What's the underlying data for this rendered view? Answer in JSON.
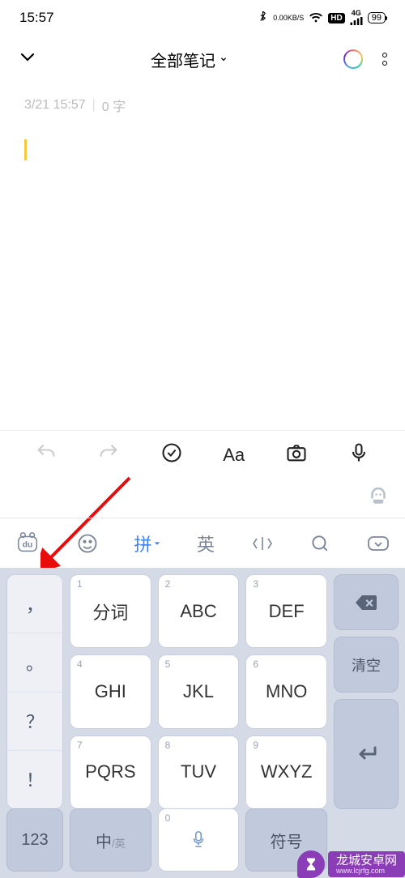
{
  "status": {
    "time": "15:57",
    "net_rate": "0.00",
    "net_unit": "KB/S",
    "hd": "HD",
    "sig": "4G",
    "battery": "99"
  },
  "header": {
    "title": "全部笔记"
  },
  "note_meta": {
    "date": "3/21 15:57",
    "words": "0 字"
  },
  "toolbar": {
    "aa": "Aa"
  },
  "ime": {
    "pin": "拼",
    "eng": "英",
    "left_syms": [
      "，",
      "。",
      "？",
      "！"
    ],
    "keys": {
      "k1_label": "分词",
      "k2_num": "2",
      "k2_label": "ABC",
      "k3_num": "3",
      "k3_label": "DEF",
      "k4_num": "4",
      "k4_label": "GHI",
      "k5_num": "5",
      "k5_label": "JKL",
      "k6_num": "6",
      "k6_label": "MNO",
      "k7_num": "7",
      "k7_label": "PQRS",
      "k8_num": "8",
      "k8_label": "TUV",
      "k9_num": "9",
      "k9_label": "WXYZ",
      "clear": "清空",
      "num": "123",
      "zh": "中",
      "zh_sub": "/英",
      "space_num": "0",
      "sym": "符号"
    }
  },
  "watermark": {
    "text": "龙城安卓网",
    "url": "www.lcjrfg.com"
  }
}
